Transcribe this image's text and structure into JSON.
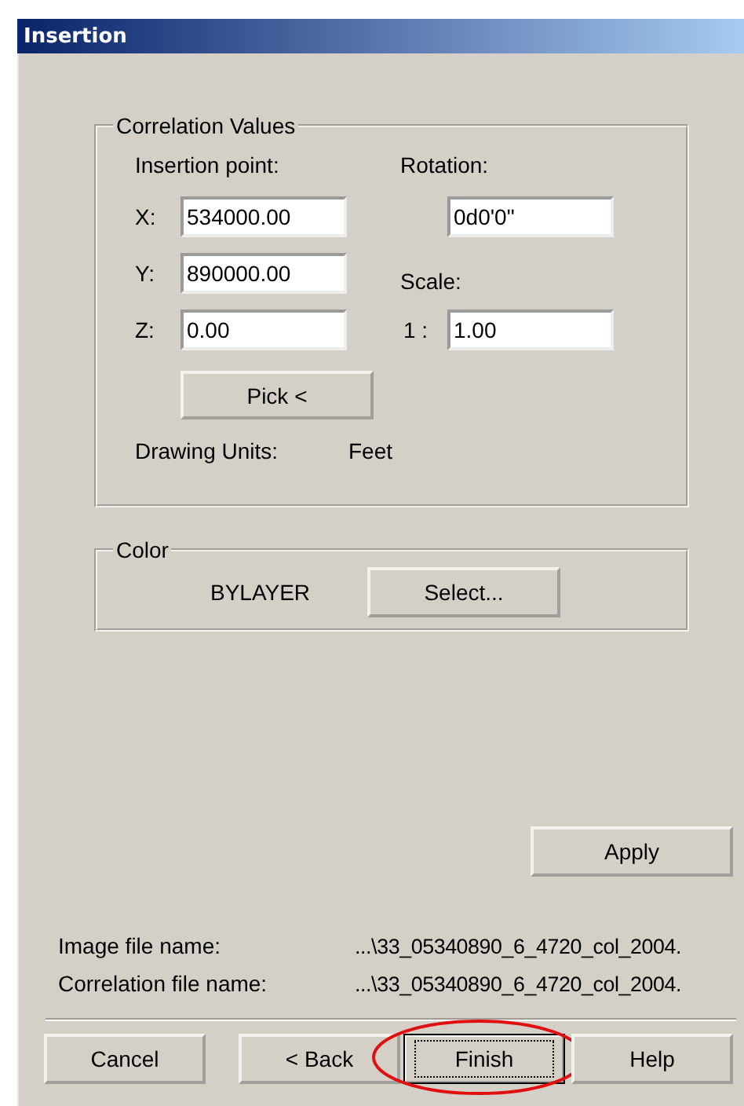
{
  "window": {
    "title": "Insertion"
  },
  "correlation_values": {
    "title": "Correlation Values",
    "insertion_point_label": "Insertion point:",
    "fields": [
      {
        "label": "X:",
        "value": "534000.00"
      },
      {
        "label": "Y:",
        "value": "890000.00"
      },
      {
        "label": "Z:",
        "value": "0.00"
      }
    ],
    "rotation": {
      "label": "Rotation:",
      "value": "0d0'0\""
    },
    "scale": {
      "label": "Scale:",
      "prefix": "1 :",
      "value": "1.00"
    },
    "pick_button": "Pick <",
    "drawing_units": {
      "label": "Drawing Units:",
      "value": "Feet"
    }
  },
  "color": {
    "title": "Color",
    "value": "BYLAYER",
    "button": "Select..."
  },
  "apply_button": "Apply",
  "files": [
    {
      "label": "Image file name:",
      "value": "...\\33_05340890_6_4720_col_2004."
    },
    {
      "label": "Correlation file name:",
      "value": "...\\33_05340890_6_4720_col_2004."
    }
  ],
  "buttons": [
    {
      "label": "Cancel",
      "default": false,
      "highlighted": false
    },
    {
      "label": "< Back",
      "default": false,
      "highlighted": false
    },
    {
      "label": "Finish",
      "default": true,
      "highlighted": true
    },
    {
      "label": "Help",
      "default": false,
      "highlighted": false
    }
  ]
}
